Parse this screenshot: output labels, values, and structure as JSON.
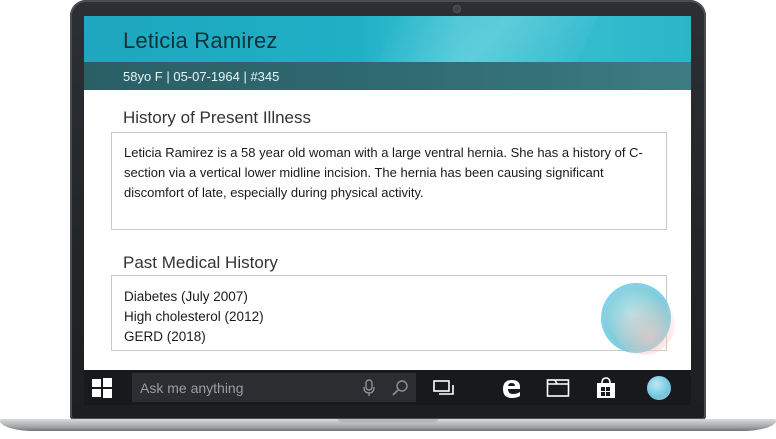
{
  "patient": {
    "name": "Leticia Ramirez",
    "meta": "58yo F | 05-07-1964  | #345"
  },
  "hpi": {
    "title": "History of Present Illness",
    "text": "Leticia Ramirez is a 58 year old woman with a large ventral hernia. She has a history of C-section via a vertical lower midline incision. The hernia has been causing significant discomfort of late, especially during physical activity."
  },
  "pmh": {
    "title": "Past Medical History",
    "items": [
      "Diabetes (July 2007)",
      "High cholesterol (2012)",
      "GERD (2018)"
    ]
  },
  "taskbar": {
    "search_placeholder": "Ask me anything",
    "icons": [
      "windows-start-icon",
      "microphone-icon",
      "search-icon",
      "task-view-icon",
      "edge-browser-icon",
      "file-explorer-icon",
      "store-icon",
      "cortana-icon"
    ]
  },
  "colors": {
    "header_accent": "#1fb0c6",
    "subbar": "#2f6a70",
    "taskbar": "#17191c"
  }
}
